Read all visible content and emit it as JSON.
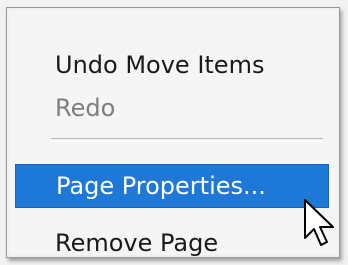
{
  "menu": {
    "items": [
      {
        "label": "Undo Move Items",
        "state": "enabled"
      },
      {
        "label": "Redo",
        "state": "disabled"
      },
      {
        "label": "Page Properties...",
        "state": "highlighted"
      },
      {
        "label": "Remove Page",
        "state": "enabled"
      }
    ],
    "highlight_color": "#1e78d7",
    "disabled_color": "#7f7f7f"
  },
  "cursor": {
    "icon": "mouse-pointer-icon"
  }
}
